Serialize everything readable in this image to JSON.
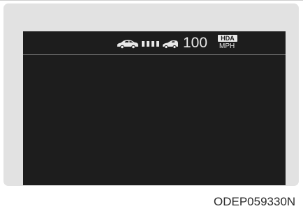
{
  "display": {
    "set_speed": "100",
    "speed_unit": "MPH",
    "hda_badge": "HDA",
    "icons": {
      "lead_vehicle": "lead-car-icon",
      "following_distance": "distance-bars-icon",
      "own_vehicle": "own-car-icon"
    },
    "following_distance_level": 4
  },
  "caption": {
    "figure_code": "ODEP059330N"
  },
  "colors": {
    "display_background": "#1d1d1d",
    "display_text": "#e8e8e8",
    "frame": "#e2e2e2"
  }
}
